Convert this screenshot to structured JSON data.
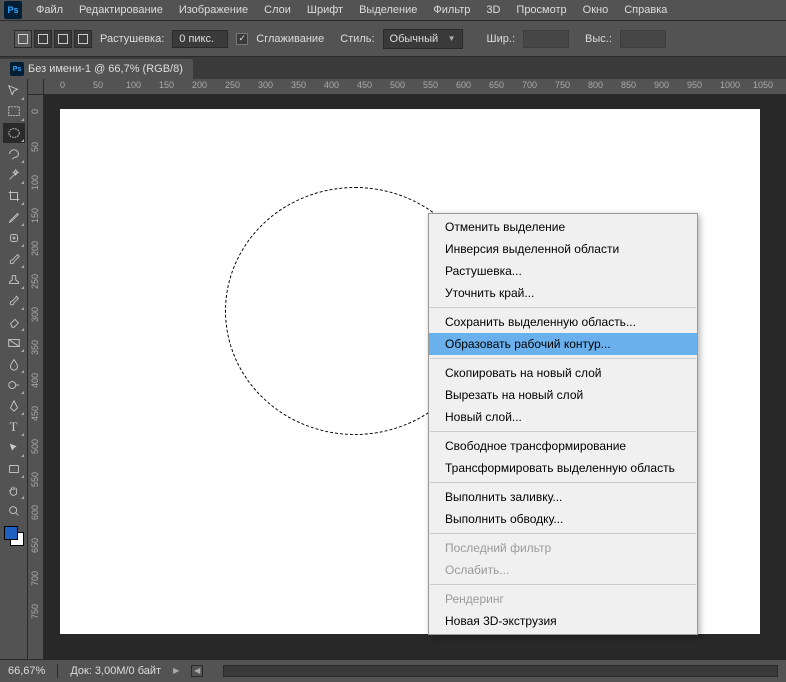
{
  "menubar": {
    "items": [
      "Файл",
      "Редактирование",
      "Изображение",
      "Слои",
      "Шрифт",
      "Выделение",
      "Фильтр",
      "3D",
      "Просмотр",
      "Окно",
      "Справка"
    ]
  },
  "optbar": {
    "feather_label": "Растушевка:",
    "feather_value": "0 пикс.",
    "antialias_label": "Сглаживание",
    "style_label": "Стиль:",
    "style_value": "Обычный",
    "width_label": "Шир.:",
    "height_label": "Выс.:"
  },
  "doc_tab": {
    "title": "Без имени-1 @ 66,7% (RGB/8)"
  },
  "ruler_h": [
    "0",
    "50",
    "100",
    "150",
    "200",
    "250",
    "300",
    "350",
    "400",
    "450",
    "500",
    "550",
    "600",
    "650",
    "700",
    "750",
    "800",
    "850",
    "900",
    "950",
    "1000",
    "1050"
  ],
  "ruler_v": [
    "0",
    "50",
    "100",
    "150",
    "200",
    "250",
    "300",
    "350",
    "400",
    "450",
    "500",
    "550",
    "600",
    "650",
    "700",
    "750"
  ],
  "context_menu": {
    "items": [
      {
        "label": "Отменить выделение",
        "enabled": true
      },
      {
        "label": "Инверсия выделенной области",
        "enabled": true
      },
      {
        "label": "Растушевка...",
        "enabled": true
      },
      {
        "label": "Уточнить край...",
        "enabled": true
      },
      {
        "sep": true
      },
      {
        "label": "Сохранить выделенную область...",
        "enabled": true
      },
      {
        "label": "Образовать рабочий контур...",
        "enabled": true,
        "highlighted": true
      },
      {
        "sep": true
      },
      {
        "label": "Скопировать на новый слой",
        "enabled": true
      },
      {
        "label": "Вырезать на новый слой",
        "enabled": true
      },
      {
        "label": "Новый слой...",
        "enabled": true
      },
      {
        "sep": true
      },
      {
        "label": "Свободное трансформирование",
        "enabled": true
      },
      {
        "label": "Трансформировать выделенную область",
        "enabled": true
      },
      {
        "sep": true
      },
      {
        "label": "Выполнить заливку...",
        "enabled": true
      },
      {
        "label": "Выполнить обводку...",
        "enabled": true
      },
      {
        "sep": true
      },
      {
        "label": "Последний фильтр",
        "enabled": false
      },
      {
        "label": "Ослабить...",
        "enabled": false
      },
      {
        "sep": true
      },
      {
        "label": "Рендеринг",
        "enabled": false
      },
      {
        "label": "Новая 3D-экструзия",
        "enabled": true
      }
    ]
  },
  "statusbar": {
    "zoom": "66,67%",
    "doc_info": "Док: 3,00M/0 байт"
  }
}
